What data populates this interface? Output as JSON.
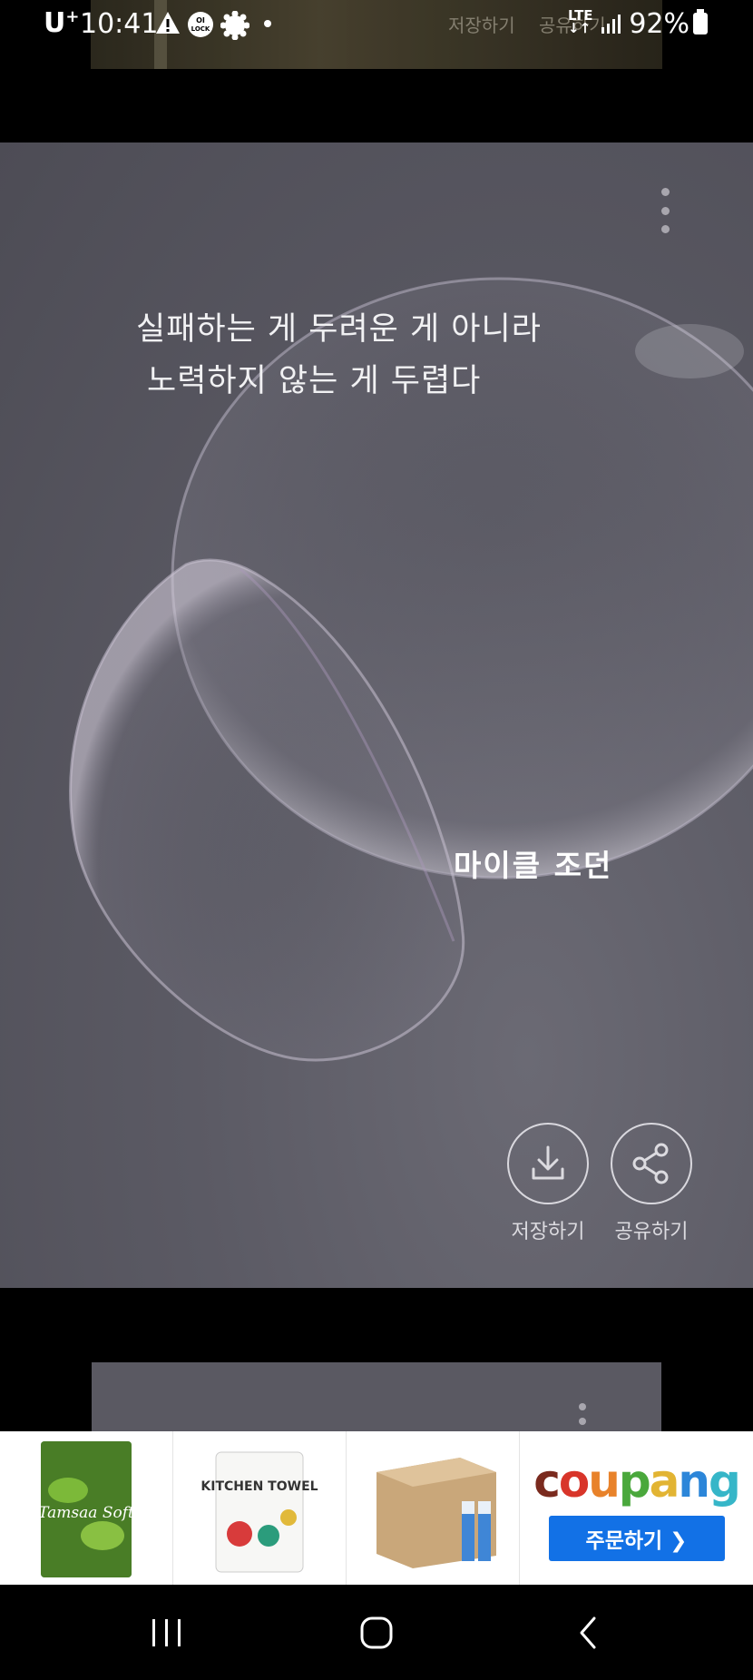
{
  "status_bar": {
    "carrier": "U",
    "carrier_sup": "+",
    "time": "10:41",
    "network": "LTE",
    "battery": "92%"
  },
  "ghost_labels": {
    "save": "저장하기",
    "share": "공유하기"
  },
  "quote": {
    "line1": "실패하는 게 두려운 게 아니라",
    "line2": "노력하지 않는 게 두렵다",
    "author": "마이클 조던"
  },
  "actions": {
    "save_label": "저장하기",
    "share_label": "공유하기"
  },
  "ad": {
    "products": [
      {
        "name": "Tamsaa Soft"
      },
      {
        "name": "KITCHEN TOWEL"
      },
      {
        "name": "battery box"
      }
    ],
    "brand": "coupang",
    "order_label": "주문하기 ❯"
  },
  "colors": {
    "ad_button": "#1271e6",
    "card_bg": "#5b5a64"
  }
}
